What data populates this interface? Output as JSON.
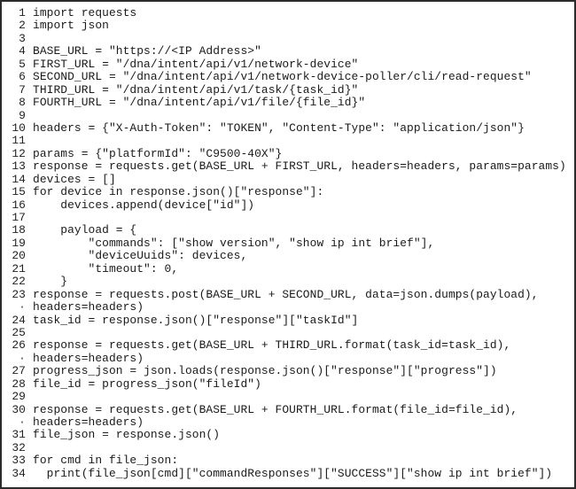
{
  "code_listing": {
    "language": "python",
    "lines": [
      {
        "n": "1",
        "text": "import requests"
      },
      {
        "n": "2",
        "text": "import json"
      },
      {
        "n": "3",
        "text": ""
      },
      {
        "n": "4",
        "text": "BASE_URL = \"https://<IP Address>\""
      },
      {
        "n": "5",
        "text": "FIRST_URL = \"/dna/intent/api/v1/network-device\""
      },
      {
        "n": "6",
        "text": "SECOND_URL = \"/dna/intent/api/v1/network-device-poller/cli/read-request\""
      },
      {
        "n": "7",
        "text": "THIRD_URL = \"/dna/intent/api/v1/task/{task_id}\""
      },
      {
        "n": "8",
        "text": "FOURTH_URL = \"/dna/intent/api/v1/file/{file_id}\""
      },
      {
        "n": "9",
        "text": ""
      },
      {
        "n": "10",
        "text": "headers = {\"X-Auth-Token\": \"TOKEN\", \"Content-Type\": \"application/json\"}"
      },
      {
        "n": "11",
        "text": ""
      },
      {
        "n": "12",
        "text": "params = {\"platformId\": \"C9500-40X\"}"
      },
      {
        "n": "13",
        "text": "response = requests.get(BASE_URL + FIRST_URL, headers=headers, params=params)"
      },
      {
        "n": "14",
        "text": "devices = []"
      },
      {
        "n": "15",
        "text": "for device in response.json()[\"response\"]:"
      },
      {
        "n": "16",
        "text": "    devices.append(device[\"id\"])"
      },
      {
        "n": "17",
        "text": ""
      },
      {
        "n": "18",
        "text": "    payload = {"
      },
      {
        "n": "19",
        "text": "        \"commands\": [\"show version\", \"show ip int brief\"],"
      },
      {
        "n": "20",
        "text": "        \"deviceUuids\": devices,"
      },
      {
        "n": "21",
        "text": "        \"timeout\": 0,"
      },
      {
        "n": "22",
        "text": "    }"
      },
      {
        "n": "23",
        "text": "response = requests.post(BASE_URL + SECOND_URL, data=json.dumps(payload),"
      },
      {
        "n": "·",
        "text": "headers=headers)"
      },
      {
        "n": "24",
        "text": "task_id = response.json()[\"response\"][\"taskId\"]"
      },
      {
        "n": "25",
        "text": ""
      },
      {
        "n": "26",
        "text": "response = requests.get(BASE_URL + THIRD_URL.format(task_id=task_id),"
      },
      {
        "n": "·",
        "text": "headers=headers)"
      },
      {
        "n": "27",
        "text": "progress_json = json.loads(response.json()[\"response\"][\"progress\"])"
      },
      {
        "n": "28",
        "text": "file_id = progress_json(\"fileId\")"
      },
      {
        "n": "29",
        "text": ""
      },
      {
        "n": "30",
        "text": "response = requests.get(BASE_URL + FOURTH_URL.format(file_id=file_id),"
      },
      {
        "n": "·",
        "text": "headers=headers)"
      },
      {
        "n": "31",
        "text": "file_json = response.json()"
      },
      {
        "n": "32",
        "text": ""
      },
      {
        "n": "33",
        "text": "for cmd in file_json:"
      },
      {
        "n": "34",
        "text": "  print(file_json[cmd][\"commandResponses\"][\"SUCCESS\"][\"show ip int brief\"])"
      }
    ]
  }
}
